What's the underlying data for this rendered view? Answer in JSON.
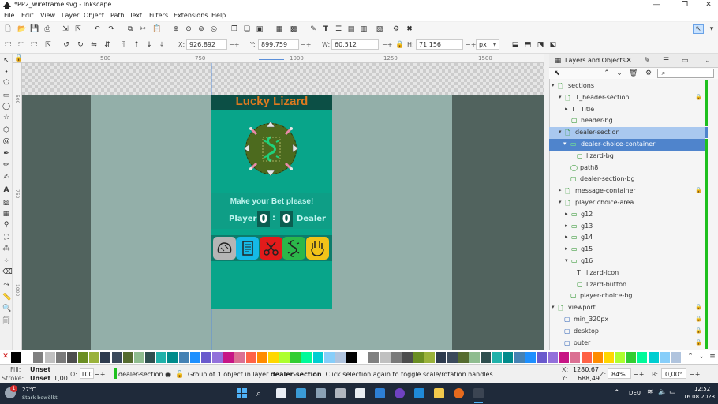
{
  "window": {
    "title": "*PP2_wireframe.svg - Inkscape",
    "minimize": "—",
    "restore": "❐",
    "close": "✕"
  },
  "menu": [
    "File",
    "Edit",
    "View",
    "Layer",
    "Object",
    "Path",
    "Text",
    "Filters",
    "Extensions",
    "Help"
  ],
  "tool_controls": {
    "x_label": "X:",
    "x_value": "926,892",
    "y_label": "Y:",
    "y_value": "899,759",
    "w_label": "W:",
    "w_value": "60,512",
    "h_label": "H:",
    "h_value": "71,156",
    "unit": "px"
  },
  "ruler": {
    "marks": [
      "500",
      "750",
      "1000",
      "1250",
      "1500"
    ],
    "vmarks": [
      "500",
      "750",
      "1000"
    ]
  },
  "canvas": {
    "header_title": "Lucky Lizard",
    "bet_text": "Make your Bet please!",
    "player_label": "Player",
    "player_score": "0",
    "separator": ":",
    "dealer_score": "0",
    "dealer_label": "Dealer",
    "choices": [
      {
        "name": "rock",
        "color": "#b5b5b5",
        "icon": "rock-icon"
      },
      {
        "name": "paper",
        "color": "#15b9e6",
        "icon": "paper-icon"
      },
      {
        "name": "scissors",
        "color": "#e21b1b",
        "icon": "scissors-icon"
      },
      {
        "name": "lizard",
        "color": "#2bb84a",
        "icon": "lizard-icon"
      },
      {
        "name": "spock",
        "color": "#f2c319",
        "icon": "spock-hand-icon"
      }
    ]
  },
  "layers_panel": {
    "tab_title": "Layers and Objects",
    "rows": [
      {
        "label": "sections",
        "indent": 0,
        "arrow": "▾",
        "type": "layer"
      },
      {
        "label": "1_header-section",
        "indent": 1,
        "arrow": "▾",
        "type": "layer",
        "lock": true
      },
      {
        "label": "Title",
        "indent": 2,
        "arrow": "▸",
        "type": "text"
      },
      {
        "label": "header-bg",
        "indent": 2,
        "arrow": "",
        "type": "rect"
      },
      {
        "label": "dealer-section",
        "indent": 1,
        "arrow": "▾",
        "type": "layer",
        "state": "sel"
      },
      {
        "label": "dealer-choice-container",
        "indent": 2,
        "arrow": "▾",
        "type": "group",
        "state": "sel2"
      },
      {
        "label": "lizard-bg",
        "indent": 3,
        "arrow": "",
        "type": "rect"
      },
      {
        "label": "path8",
        "indent": 2,
        "arrow": "",
        "type": "circle"
      },
      {
        "label": "dealer-section-bg",
        "indent": 2,
        "arrow": "",
        "type": "rect"
      },
      {
        "label": "message-container",
        "indent": 1,
        "arrow": "▸",
        "type": "layer",
        "lock": true
      },
      {
        "label": "player choice-area",
        "indent": 1,
        "arrow": "▾",
        "type": "layer"
      },
      {
        "label": "g12",
        "indent": 2,
        "arrow": "▸",
        "type": "group"
      },
      {
        "label": "g13",
        "indent": 2,
        "arrow": "▸",
        "type": "group"
      },
      {
        "label": "g14",
        "indent": 2,
        "arrow": "▸",
        "type": "group"
      },
      {
        "label": "g15",
        "indent": 2,
        "arrow": "▸",
        "type": "group"
      },
      {
        "label": "g16",
        "indent": 2,
        "arrow": "▾",
        "type": "group"
      },
      {
        "label": "lizard-icon",
        "indent": 3,
        "arrow": "",
        "type": "text"
      },
      {
        "label": "lizard-button",
        "indent": 3,
        "arrow": "",
        "type": "rect"
      },
      {
        "label": "player-choice-bg",
        "indent": 2,
        "arrow": "",
        "type": "rect"
      },
      {
        "label": "viewport",
        "indent": 0,
        "arrow": "▾",
        "type": "layer",
        "lock": true
      },
      {
        "label": "min_320px",
        "indent": 1,
        "arrow": "",
        "type": "rect",
        "lock": true
      },
      {
        "label": "desktop",
        "indent": 1,
        "arrow": "",
        "type": "rect",
        "lock": true
      },
      {
        "label": "outer",
        "indent": 1,
        "arrow": "",
        "type": "rect",
        "lock": true
      }
    ]
  },
  "palette_colors": [
    "#000000",
    "#ffffff",
    "#808080",
    "#c0c0c0",
    "#7a7a7a",
    "#4d4d4d",
    "#6b8e23",
    "#9ab23b",
    "#2e3b4e",
    "#3c4a5c",
    "#556b2f",
    "#8fbc8f",
    "#2f4f4f",
    "#20b2aa",
    "#008b8b",
    "#4682b4",
    "#1e90ff",
    "#6a5acd",
    "#9370db",
    "#c71585",
    "#db7093",
    "#ff6347",
    "#ff8c00",
    "#ffd700",
    "#adff2f",
    "#32cd32",
    "#00fa9a",
    "#00ced1",
    "#87cefa",
    "#b0c4de"
  ],
  "status": {
    "fill_label": "Fill:",
    "fill_value": "Unset",
    "stroke_label": "Stroke:",
    "stroke_value": "Unset",
    "stroke_width": "1,00",
    "opacity_label": "O:",
    "opacity_value": "100",
    "layer_name": "dealer-section",
    "message_prefix": "Group of ",
    "message_count": "1",
    "message_middle": " object in layer ",
    "message_layer": "dealer-section",
    "message_suffix": ". Click selection again to toggle scale/rotation handles.",
    "x_label": "X:",
    "x_coord": "1280,67",
    "y_label": "Y:",
    "y_coord": "688,49",
    "zoom_label": "Z:",
    "zoom": "84%",
    "rotation_label": "R:",
    "rotation": "0,00°"
  },
  "taskbar": {
    "weather_temp": "27°C",
    "weather_desc": "Stark bewölkt",
    "weather_badge": "1",
    "lang": "DEU",
    "time": "12:52",
    "date": "16.08.2023"
  }
}
